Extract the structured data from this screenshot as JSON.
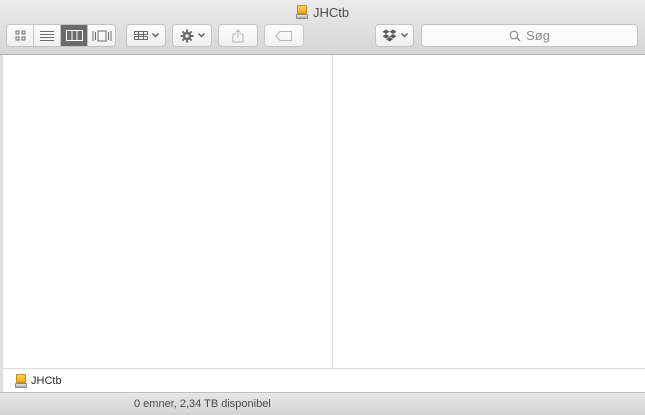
{
  "window": {
    "title": "JHCtb"
  },
  "toolbar": {
    "view_modes": [
      {
        "name": "icon-view",
        "icon": "grid-icon",
        "active": false
      },
      {
        "name": "list-view",
        "icon": "list-icon",
        "active": false
      },
      {
        "name": "column-view",
        "icon": "columns-icon",
        "active": true
      },
      {
        "name": "coverflow-view",
        "icon": "coverflow-icon",
        "active": false
      }
    ],
    "arrange_icon": "arrange-icon",
    "action_icon": "gear-icon",
    "share_icon": "share-icon",
    "tag_icon": "tag-icon",
    "dropbox_icon": "dropbox-icon",
    "search_placeholder": "Søg"
  },
  "pathbar": {
    "items": [
      "JHCtb"
    ]
  },
  "statusbar": {
    "text": "0 emner, 2,34 TB disponibel"
  },
  "colors": {
    "active_segment": "#6a6a6a",
    "disk_orange": "#f3a91d"
  }
}
